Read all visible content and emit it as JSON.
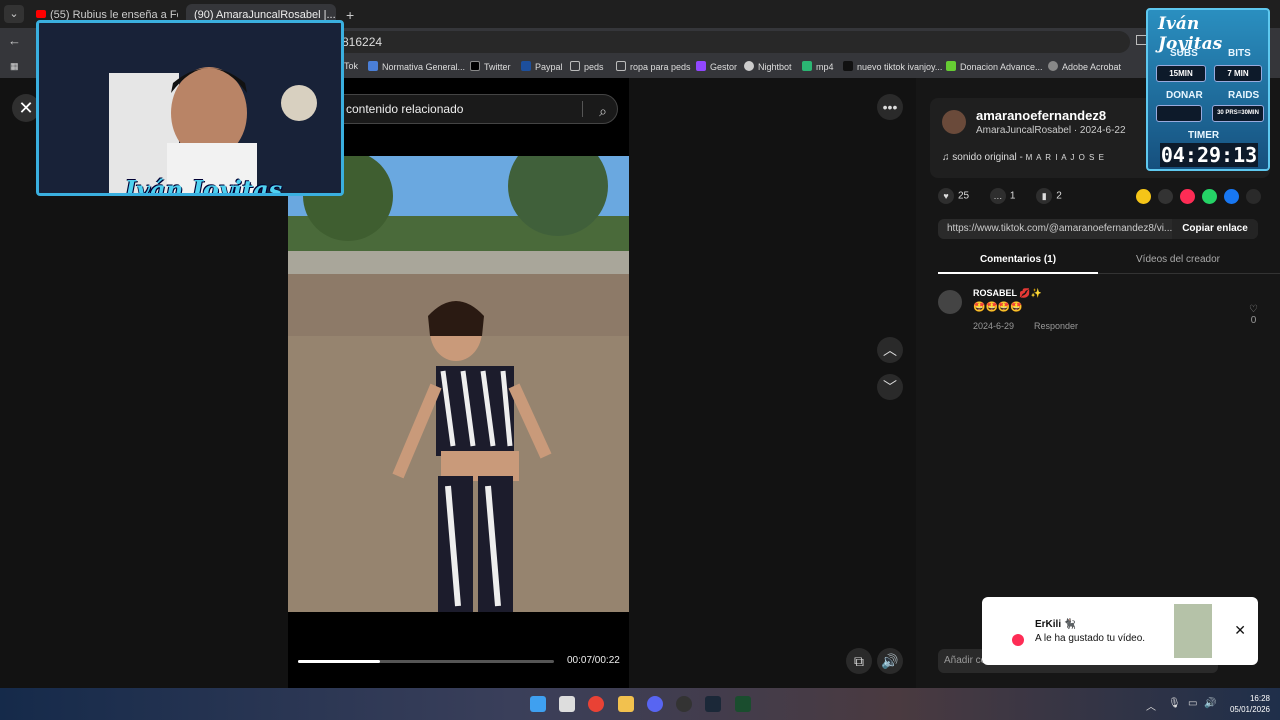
{
  "browser": {
    "tabs": [
      {
        "title": "(55) Rubius le enseña a Folag..."
      },
      {
        "title": "(90) AmaraJuncalRosabel |..."
      }
    ],
    "url_fragment": "816224",
    "bookmarks": [
      "Tok",
      "Normativa General...",
      "Twitter",
      "Paypal",
      "peds",
      "ropa para peds",
      "Gestor",
      "Nightbot",
      "mp4",
      "nuevo tiktok ivanjoy...",
      "Donacion Advance...",
      "Adobe Acrobat"
    ]
  },
  "player": {
    "search_placeholder": "contenido relacionado",
    "time": "00:07/00:22",
    "progress": 0.32
  },
  "author": {
    "username": "amaranoefernandez8",
    "subline": "AmaraJuncalRosabel · 2024-6-22",
    "sound_label": "sonido original -",
    "sound_artist": "M A R I A J O S E"
  },
  "stats": {
    "likes": "25",
    "comments": "1",
    "saves": "2"
  },
  "share_colors": [
    "#f5c518",
    "#333333",
    "#fe2c55",
    "#25d366",
    "#1877f2",
    "#2a2a2a"
  ],
  "link": {
    "url": "https://www.tiktok.com/@amaranoefernandez8/vi...",
    "copy_label": "Copiar enlace"
  },
  "panel_tabs": {
    "comments": "Comentarios (1)",
    "creator_videos": "Vídeos del creador"
  },
  "comment": {
    "name": "ROSABEL 💋✨",
    "text": "🤩🤩🤩🤩",
    "date": "2024-6-29",
    "reply": "Responder",
    "likes": "0"
  },
  "add_comment": "Añadir co",
  "notification": {
    "user": "ErKili 🐈‍⬛",
    "text": "A le ha gustado tu vídeo."
  },
  "stream_overlay": {
    "webcam_title": "Iván Joyitas",
    "title": "Iván Joyitas",
    "subs_label": "SUBS",
    "subs_value": "15MIN",
    "bits_label": "BITS",
    "bits_value": "7 MIN",
    "donar_label": "DONAR",
    "donar_value": "",
    "raids_label": "RAIDS",
    "raids_value": "30 PRS=30MIN",
    "timer_label": "TIMER",
    "timer_value": "04:29:13"
  },
  "taskbar": {
    "time": "16:28",
    "date": "05/01/2026"
  }
}
